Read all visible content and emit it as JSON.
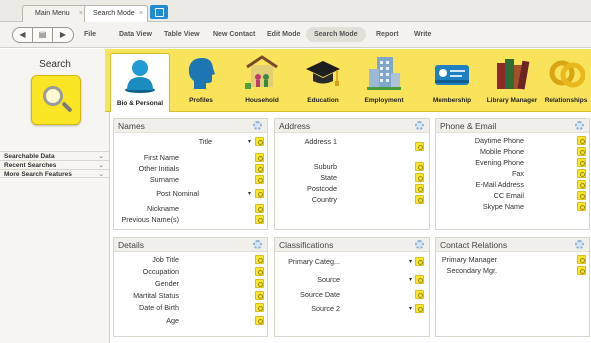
{
  "tabs": [
    {
      "label": "Main Menu",
      "close": "×"
    },
    {
      "label": "Search Mode",
      "close": "×"
    }
  ],
  "toolbar": {
    "nav": [
      "◀",
      "▤",
      "▶"
    ],
    "menu": [
      "File",
      "Data View",
      "Table View",
      "New Contact",
      "Edit Mode",
      "Search Mode",
      "Report",
      "Write"
    ]
  },
  "left_panel": {
    "title": "Search",
    "items": [
      {
        "label": "Searchable Data",
        "chevron": "⌄"
      },
      {
        "label": "Recent Searches",
        "chevron": "⌄"
      },
      {
        "label": "More Search Features",
        "chevron": "⌄"
      }
    ]
  },
  "categories": [
    {
      "label": "Bio & Personal",
      "icon": "person-icon"
    },
    {
      "label": "Profiles",
      "icon": "head-profile-icon"
    },
    {
      "label": "Household",
      "icon": "house-icon"
    },
    {
      "label": "Education",
      "icon": "graduation-cap-icon"
    },
    {
      "label": "Employment",
      "icon": "building-icon"
    },
    {
      "label": "Membership",
      "icon": "membership-card-icon"
    },
    {
      "label": "Library Manager",
      "icon": "books-icon"
    },
    {
      "label": "Relationships",
      "icon": "rings-icon"
    }
  ],
  "cards": {
    "names": {
      "title": "Names",
      "fields": [
        {
          "label": "Title",
          "dropdown": true
        },
        {
          "label": "First Name"
        },
        {
          "label": "Other Initials"
        },
        {
          "label": "Surname"
        },
        {
          "label": "Post Nominal",
          "dropdown": true
        },
        {
          "label": "Nickname"
        },
        {
          "label": "Previous Name(s)"
        }
      ]
    },
    "address": {
      "title": "Address",
      "fields": [
        {
          "label": "Address 1"
        },
        {
          "label": "Suburb"
        },
        {
          "label": "State"
        },
        {
          "label": "Postcode"
        },
        {
          "label": "Country"
        }
      ]
    },
    "phone": {
      "title": "Phone & Email",
      "fields": [
        {
          "label": "Daytime Phone"
        },
        {
          "label": "Mobile Phone"
        },
        {
          "label": "Evening Phone"
        },
        {
          "label": "Fax"
        },
        {
          "label": "E-Mail Address"
        },
        {
          "label": "CC Email"
        },
        {
          "label": "Skype Name"
        }
      ]
    },
    "details": {
      "title": "Details",
      "fields": [
        {
          "label": "Job Title"
        },
        {
          "label": "Occupation"
        },
        {
          "label": "Gender"
        },
        {
          "label": "Martital Status"
        },
        {
          "label": "Date of Birth"
        },
        {
          "label": "Age"
        }
      ]
    },
    "classifications": {
      "title": "Classifications",
      "fields": [
        {
          "label": "Primary Categ...",
          "dropdown": true
        },
        {
          "label": "Source",
          "dropdown": true
        },
        {
          "label": "Source Date"
        },
        {
          "label": "Source 2",
          "dropdown": true
        }
      ]
    },
    "contact_relations": {
      "title": "Contact Relations",
      "fields": [
        {
          "label": "Primary Manager"
        },
        {
          "label": "Secondary Mgr."
        }
      ]
    }
  },
  "dropdown_glyph": "▾",
  "colors": {
    "accent_yellow": "#fbe626",
    "category_bar": "#f9e35a",
    "tab_blue": "#1f8bd1"
  }
}
